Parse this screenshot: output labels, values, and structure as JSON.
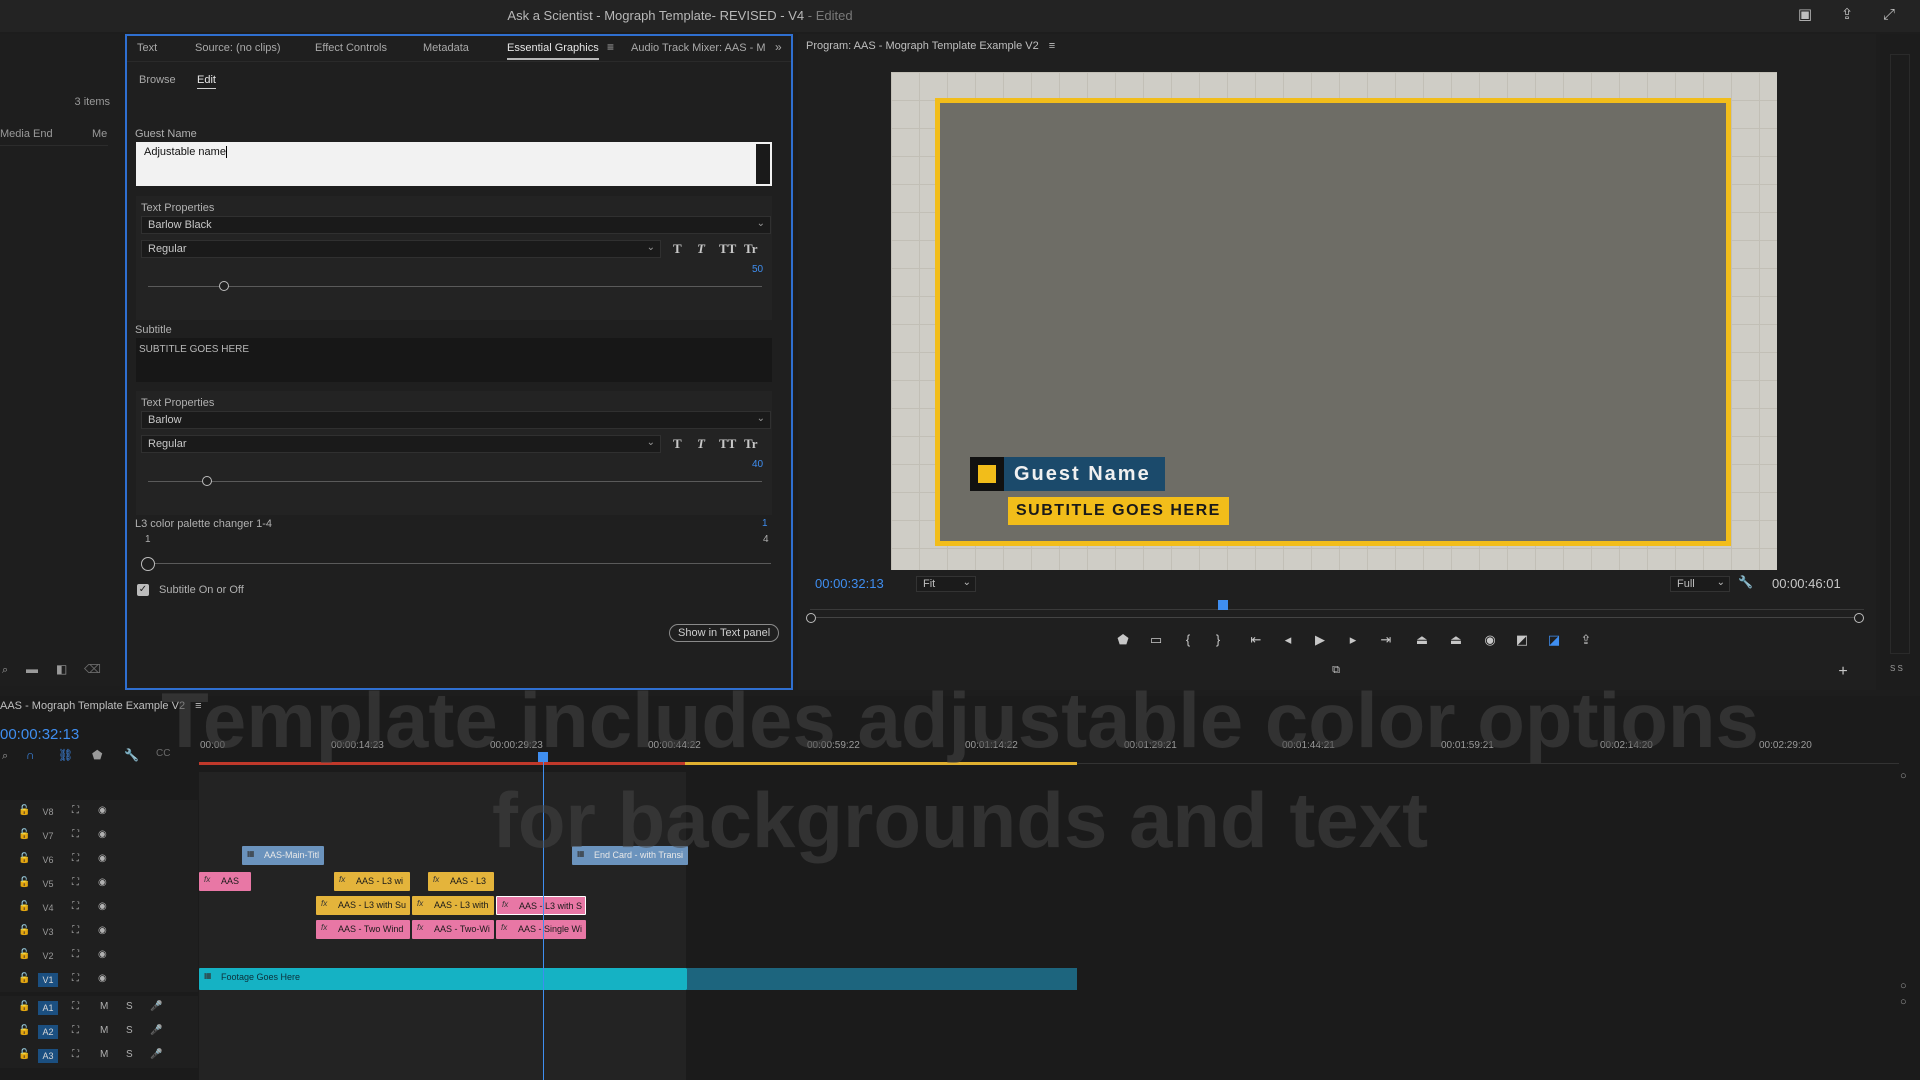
{
  "window": {
    "title": "Ask a Scientist - Mograph Template- REVISED - V4",
    "title_suffix": " - Edited"
  },
  "project": {
    "count": "3 items",
    "col_media_end": "Media End",
    "col_me": "Me"
  },
  "panel_tabs": [
    "Text",
    "Source: (no clips)",
    "Effect Controls",
    "Metadata",
    "Essential Graphics",
    "Audio Track Mixer: AAS - M"
  ],
  "essential_graphics": {
    "subtabs": [
      "Browse",
      "Edit"
    ],
    "guest_name_label": "Guest Name",
    "guest_name_value": "Adjustable name",
    "text_props_label": "Text Properties",
    "font1": "Barlow Black",
    "style1": "Regular",
    "size1": "50",
    "subtitle_label": "Subtitle",
    "subtitle_value": "SUBTITLE GOES HERE",
    "font2": "Barlow",
    "style2": "Regular",
    "size2": "40",
    "palette_label": "L3 color palette changer 1-4",
    "palette_value": "1",
    "palette_min": "1",
    "palette_max": "4",
    "subtitle_toggle": "Subtitle On or Off",
    "show_in_text": "Show in Text panel",
    "format_buttons": [
      "T",
      "T",
      "TT",
      "Tr"
    ]
  },
  "program": {
    "title": "Program: AAS - Mograph Template Example V2",
    "lower_third_name": "Guest Name",
    "lower_third_subtitle": "SUBTITLE GOES HERE",
    "timecode": "00:00:32:13",
    "duration": "00:00:46:01",
    "fit": "Fit",
    "quality": "Full",
    "colors": {
      "frame_border": "#f2bd1a",
      "name_bg": "#1b4a6b"
    }
  },
  "timeline": {
    "title": "AAS - Mograph Template Example V2",
    "timecode": "00:00:32:13",
    "ruler": [
      "00:00",
      "00:00:14:23",
      "00:00:29:23",
      "00:00:44:22",
      "00:00:59:22",
      "00:01:14:22",
      "00:01:29:21",
      "00:01:44:21",
      "00:01:59:21",
      "00:02:14:20",
      "00:02:29:20"
    ],
    "video_tracks": [
      "V8",
      "V7",
      "V6",
      "V5",
      "V4",
      "V3",
      "V2",
      "V1"
    ],
    "audio_tracks": [
      "A1",
      "A2",
      "A3"
    ],
    "clips": {
      "main_title": "AAS-Main-Titl",
      "end_card": "End Card - with Transi",
      "v5_a": "AAS",
      "v5_b": "AAS - L3 wi",
      "v5_c": "AAS - L3",
      "v4_a": "AAS - L3 with Su",
      "v4_b": "AAS - L3 with",
      "v4_c": "AAS - L3 with S",
      "v3_a": "AAS - Two Wind",
      "v3_b": "AAS - Two-Wi",
      "v3_c": "AAS - Single Wi",
      "footage": "Footage Goes Here"
    }
  },
  "overlay_text": "Template includes adjustable color options for backgrounds and text"
}
